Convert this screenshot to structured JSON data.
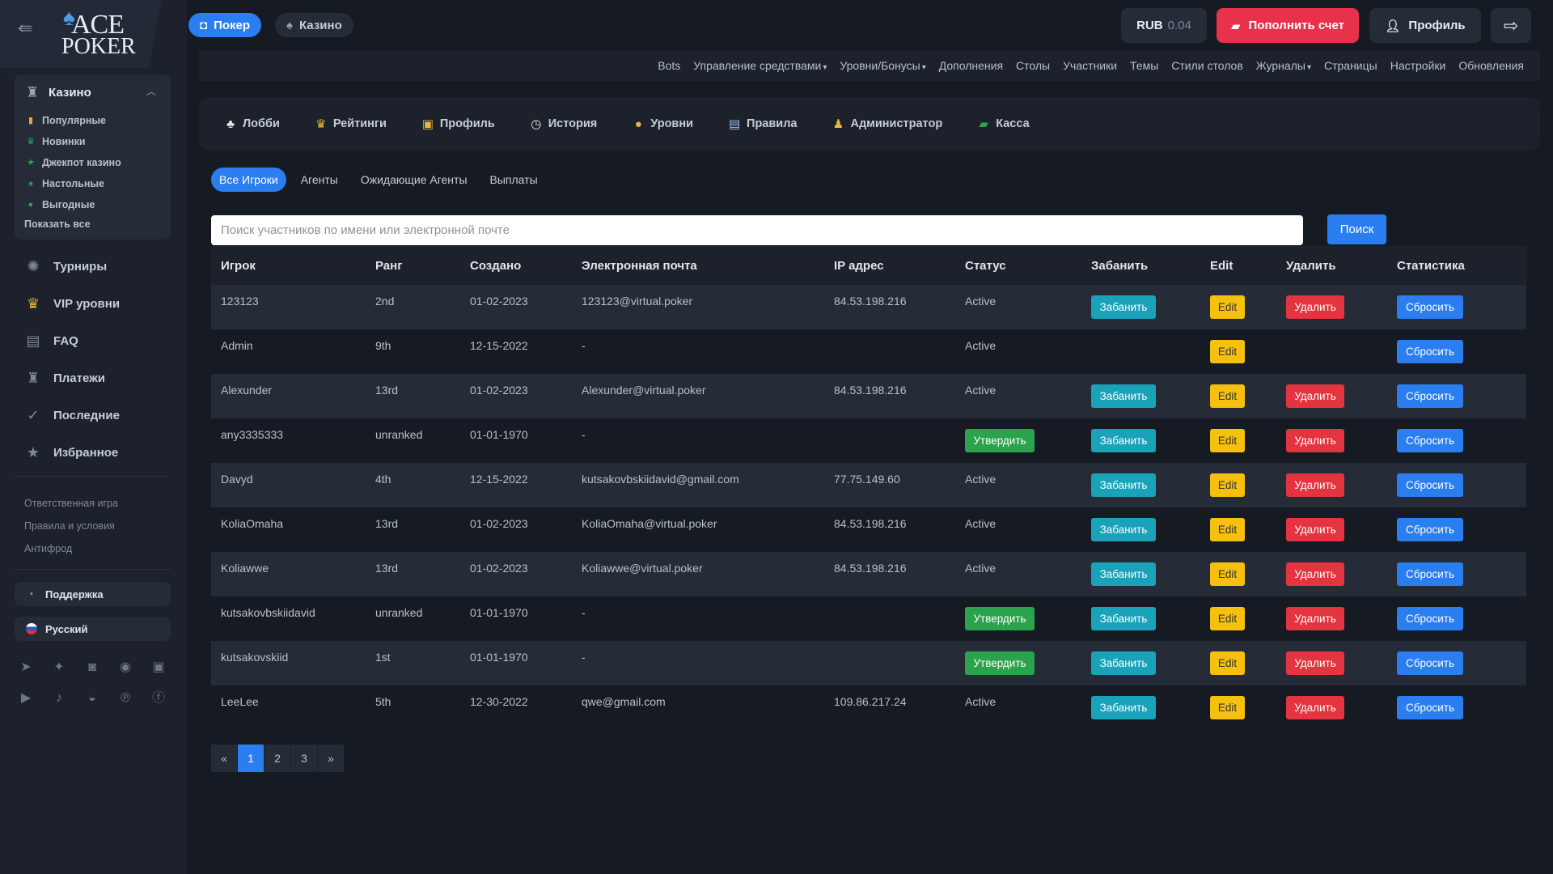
{
  "brand": {
    "logo_line1": "ACE",
    "logo_line2": "POKER"
  },
  "topbar": {
    "tab_poker": "Покер",
    "tab_casino": "Казино",
    "currency": "RUB",
    "balance": "0.04",
    "deposit_label": "Пополнить счет",
    "profile_label": "Профиль"
  },
  "sidebar": {
    "casino_title": "Казино",
    "casino_items": [
      {
        "label": "Популярные",
        "icon": "fire-icon",
        "color": "#e9a23b"
      },
      {
        "label": "Новинки",
        "icon": "trophy-icon",
        "color": "#2ba24c"
      },
      {
        "label": "Джекпот казино",
        "icon": "star-icon",
        "color": "#2ba24c"
      },
      {
        "label": "Настольные",
        "icon": "spade-icon",
        "color": "#2ba24c"
      },
      {
        "label": "Выгодные",
        "icon": "check-icon",
        "color": "#2ba24c"
      }
    ],
    "show_all": "Показать все",
    "nav": [
      {
        "label": "Турниры",
        "icon": "tournament-icon"
      },
      {
        "label": "VIP уровни",
        "icon": "crown-icon"
      },
      {
        "label": "FAQ",
        "icon": "faq-icon"
      },
      {
        "label": "Платежи",
        "icon": "payments-icon"
      },
      {
        "label": "Последние",
        "icon": "recent-icon"
      },
      {
        "label": "Избранное",
        "icon": "favorite-icon"
      }
    ],
    "links": [
      "Ответственная игра",
      "Правила и условия",
      "Антифрод"
    ],
    "support": "Поддержка",
    "language": "Русский"
  },
  "admin_menu": [
    {
      "label": "Bots",
      "dropdown": false
    },
    {
      "label": "Управление средствами",
      "dropdown": true
    },
    {
      "label": "Уровни/Бонусы",
      "dropdown": true
    },
    {
      "label": "Дополнения",
      "dropdown": false
    },
    {
      "label": "Столы",
      "dropdown": false
    },
    {
      "label": "Участники",
      "dropdown": false
    },
    {
      "label": "Темы",
      "dropdown": false
    },
    {
      "label": "Стили столов",
      "dropdown": false
    },
    {
      "label": "Журналы",
      "dropdown": true
    },
    {
      "label": "Страницы",
      "dropdown": false
    },
    {
      "label": "Настройки",
      "dropdown": false
    },
    {
      "label": "Обновления",
      "dropdown": false
    }
  ],
  "section_nav": [
    {
      "label": "Лобби",
      "icon": "lobby-icon"
    },
    {
      "label": "Рейтинги",
      "icon": "trophy-icon"
    },
    {
      "label": "Профиль",
      "icon": "profile-card-icon"
    },
    {
      "label": "История",
      "icon": "history-icon"
    },
    {
      "label": "Уровни",
      "icon": "levels-icon"
    },
    {
      "label": "Правила",
      "icon": "rules-icon"
    },
    {
      "label": "Администратор",
      "icon": "admin-icon"
    },
    {
      "label": "Касса",
      "icon": "cashier-icon"
    }
  ],
  "sub_tabs": [
    "Все Игроки",
    "Агенты",
    "Ожидающие Агенты",
    "Выплаты"
  ],
  "search": {
    "placeholder": "Поиск участников по имени или электронной почте",
    "button": "Поиск"
  },
  "table": {
    "headers": [
      "Игрок",
      "Ранг",
      "Создано",
      "Электронная почта",
      "IP адрес",
      "Статус",
      "Забанить",
      "Edit",
      "Удалить",
      "Статистика"
    ],
    "labels": {
      "ban": "Забанить",
      "edit": "Edit",
      "delete": "Удалить",
      "reset": "Сбросить",
      "approve": "Утвердить",
      "active": "Active"
    },
    "rows": [
      {
        "player": "123123",
        "rank": "2nd",
        "created": "01-02-2023",
        "email": "123123@virtual.poker",
        "ip": "84.53.198.216",
        "status": "active",
        "ban": true,
        "delete": true
      },
      {
        "player": "Admin",
        "rank": "9th",
        "created": "12-15-2022",
        "email": "-",
        "ip": "",
        "status": "active",
        "ban": false,
        "delete": false
      },
      {
        "player": "Alexunder",
        "rank": "13rd",
        "created": "01-02-2023",
        "email": "Alexunder@virtual.poker",
        "ip": "84.53.198.216",
        "status": "active",
        "ban": true,
        "delete": true
      },
      {
        "player": "any3335333",
        "rank": "unranked",
        "created": "01-01-1970",
        "email": "-",
        "ip": "",
        "status": "approve",
        "ban": true,
        "delete": true
      },
      {
        "player": "Davyd",
        "rank": "4th",
        "created": "12-15-2022",
        "email": "kutsakovbskiidavid@gmail.com",
        "ip": "77.75.149.60",
        "status": "active",
        "ban": true,
        "delete": true
      },
      {
        "player": "KoliaOmaha",
        "rank": "13rd",
        "created": "01-02-2023",
        "email": "KoliaOmaha@virtual.poker",
        "ip": "84.53.198.216",
        "status": "active",
        "ban": true,
        "delete": true
      },
      {
        "player": "Koliawwe",
        "rank": "13rd",
        "created": "01-02-2023",
        "email": "Koliawwe@virtual.poker",
        "ip": "84.53.198.216",
        "status": "active",
        "ban": true,
        "delete": true
      },
      {
        "player": "kutsakovbskiidavid",
        "rank": "unranked",
        "created": "01-01-1970",
        "email": "-",
        "ip": "",
        "status": "approve",
        "ban": true,
        "delete": true
      },
      {
        "player": "kutsakovskiid",
        "rank": "1st",
        "created": "01-01-1970",
        "email": "-",
        "ip": "",
        "status": "approve",
        "ban": true,
        "delete": true
      },
      {
        "player": "LeeLee",
        "rank": "5th",
        "created": "12-30-2022",
        "email": "qwe@gmail.com",
        "ip": "109.86.217.24",
        "status": "active",
        "ban": true,
        "delete": true
      }
    ]
  },
  "pagination": {
    "prev": "«",
    "pages": [
      "1",
      "2",
      "3"
    ],
    "current": "1",
    "next": "»"
  }
}
